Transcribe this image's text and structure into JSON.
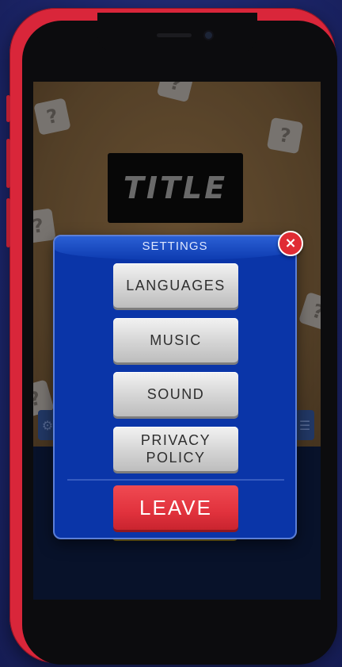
{
  "game": {
    "title": "TITLE",
    "tile_symbol": "?"
  },
  "settings": {
    "heading": "SETTINGS",
    "buttons": [
      {
        "label": "LANGUAGES"
      },
      {
        "label": "MUSIC"
      },
      {
        "label": "SOUND"
      },
      {
        "label": "PRIVACY\nPOLICY"
      }
    ],
    "leave_label": "LEAVE",
    "close_icon": "×"
  },
  "colors": {
    "phone_frame": "#d9263a",
    "modal_bg": "#0a35a8",
    "leave_button": "#e1323d",
    "close_button": "#e02c34"
  }
}
